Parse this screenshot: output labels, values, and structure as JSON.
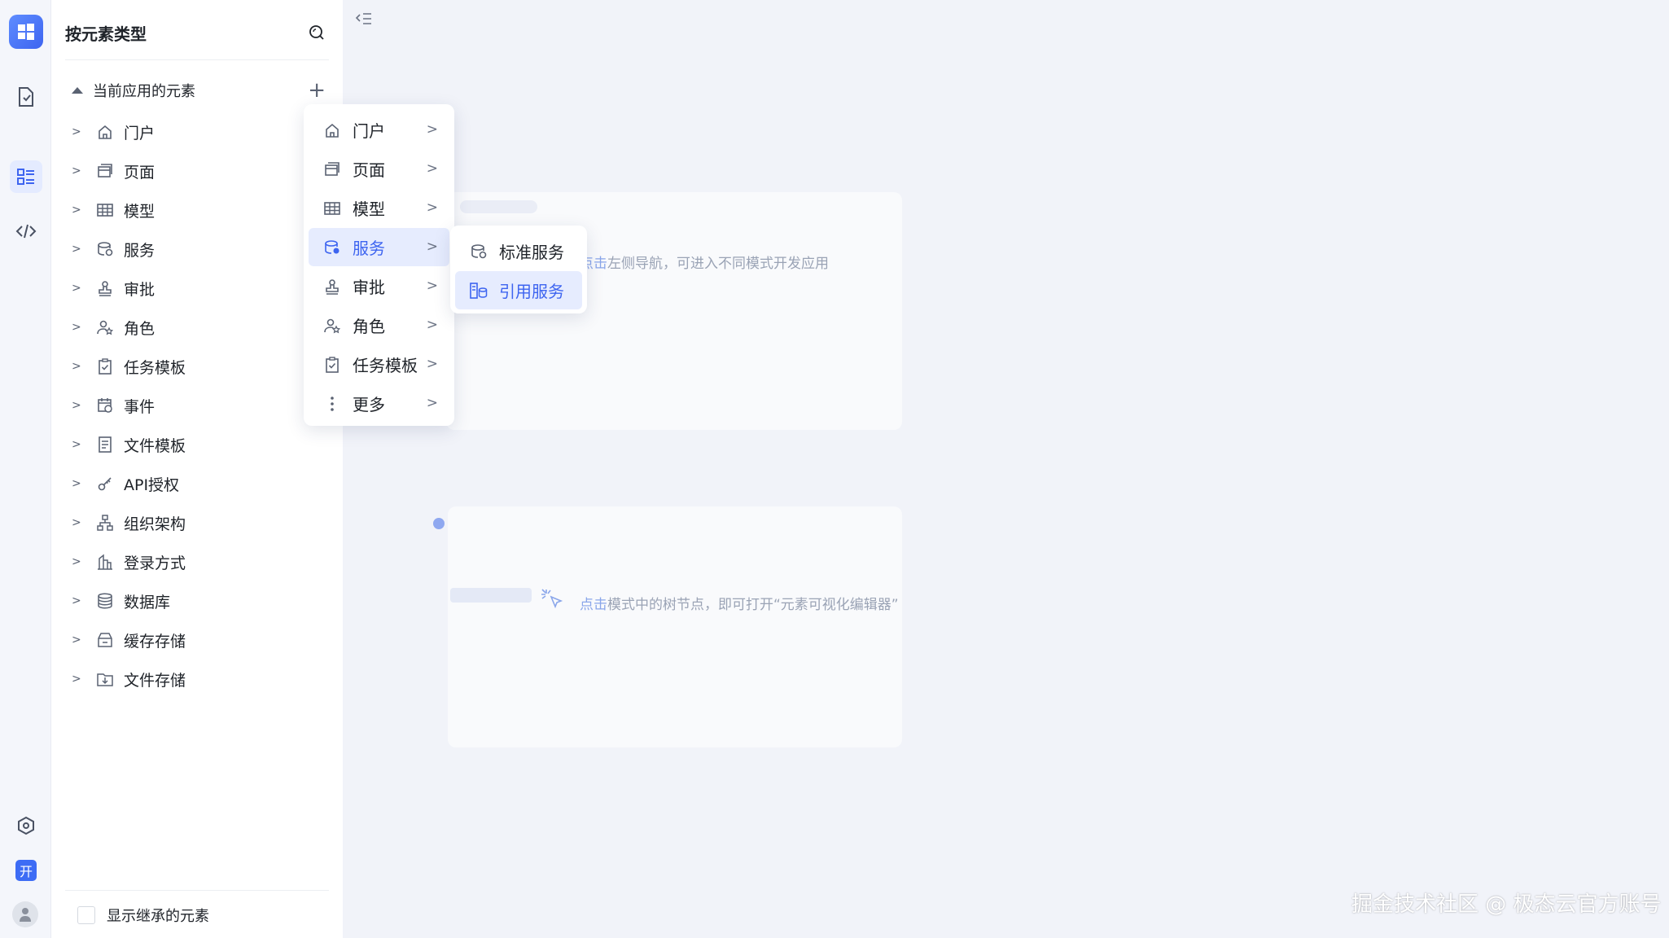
{
  "sidebar": {
    "title": "按元素类型",
    "group_label": "当前应用的元素",
    "items": [
      {
        "label": "门户",
        "icon": "home-icon"
      },
      {
        "label": "页面",
        "icon": "page-icon"
      },
      {
        "label": "模型",
        "icon": "table-icon"
      },
      {
        "label": "服务",
        "icon": "service-icon"
      },
      {
        "label": "审批",
        "icon": "stamp-icon"
      },
      {
        "label": "角色",
        "icon": "role-icon"
      },
      {
        "label": "任务模板",
        "icon": "clipboard-icon"
      },
      {
        "label": "事件",
        "icon": "event-icon"
      },
      {
        "label": "文件模板",
        "icon": "file-template-icon"
      },
      {
        "label": "API授权",
        "icon": "key-icon"
      },
      {
        "label": "组织架构",
        "icon": "org-icon"
      },
      {
        "label": "登录方式",
        "icon": "login-icon"
      },
      {
        "label": "数据库",
        "icon": "database-icon"
      },
      {
        "label": "缓存存储",
        "icon": "cache-icon"
      },
      {
        "label": "文件存储",
        "icon": "file-storage-icon"
      }
    ],
    "show_inherited_label": "显示继承的元素"
  },
  "rail": {
    "badge_label": "开"
  },
  "add_menu": {
    "items": [
      {
        "label": "门户"
      },
      {
        "label": "页面"
      },
      {
        "label": "模型"
      },
      {
        "label": "服务"
      },
      {
        "label": "审批"
      },
      {
        "label": "角色"
      },
      {
        "label": "任务模板"
      },
      {
        "label": "更多"
      }
    ],
    "submenu": [
      {
        "label": "标准服务"
      },
      {
        "label": "引用服务"
      }
    ]
  },
  "main": {
    "hint1_accent": "点击",
    "hint1_rest": "左侧导航，可进入不同模式开发应用",
    "hint2_accent": "点击",
    "hint2_rest": "模式中的树节点，即可打开“元素可视化编辑器”"
  },
  "watermark": "掘金技术社区 @ 极态云官方账号",
  "colors": {
    "accent": "#3d64f0",
    "active_bg": "#e6ecfe"
  }
}
